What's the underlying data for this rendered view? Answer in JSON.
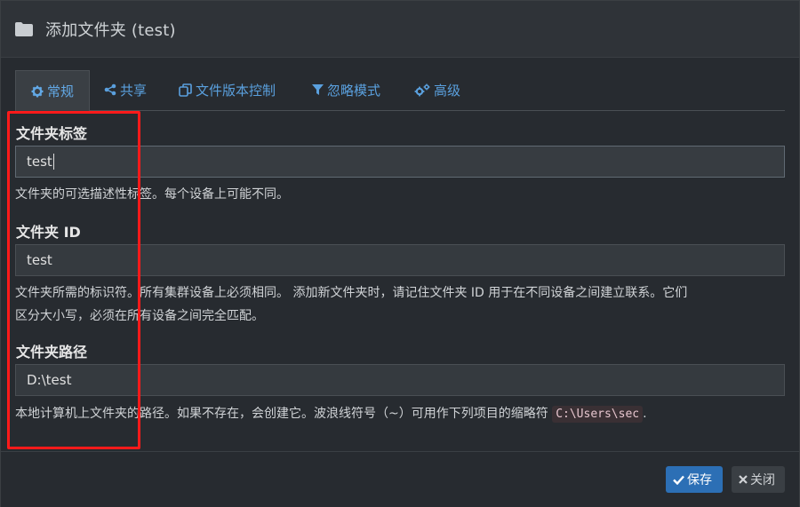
{
  "dialog": {
    "title": "添加文件夹 (test)"
  },
  "tabs": [
    {
      "label": "常规",
      "icon": "gear-icon"
    },
    {
      "label": "共享",
      "icon": "share-icon"
    },
    {
      "label": "文件版本控制",
      "icon": "copy-icon"
    },
    {
      "label": "忽略模式",
      "icon": "filter-icon"
    },
    {
      "label": "高级",
      "icon": "cogs-icon"
    }
  ],
  "fields": {
    "folder_label": {
      "label": "文件夹标签",
      "value": "test",
      "help": "文件夹的可选描述性标签。每个设备上可能不同。"
    },
    "folder_id": {
      "label": "文件夹 ID",
      "value": "test",
      "help_line1": "文件夹所需的标识符。所有集群设备上必须相同。 添加新文件夹时，请记住文件夹 ID 用于在不同设备之间建立联系。它们",
      "help_line2": "区分大小写，必须在所有设备之间完全匹配。"
    },
    "folder_path": {
      "label": "文件夹路径",
      "value": "D:\\test",
      "help_prefix": "本地计算机上文件夹的路径。如果不存在，会创建它。波浪线符号（~）可用作下列项目的缩略符",
      "help_code": "C:\\Users\\sec",
      "help_suffix": "."
    }
  },
  "footer": {
    "save_label": "保存",
    "close_label": "关闭"
  },
  "colors": {
    "accent": "#5aa0de",
    "primary_button": "#2c6fb5",
    "highlight": "#ff1a1a"
  }
}
